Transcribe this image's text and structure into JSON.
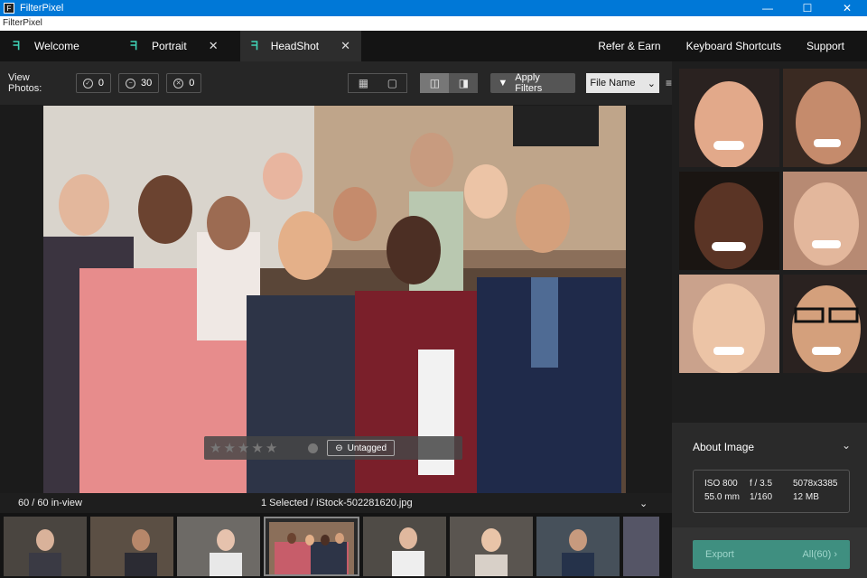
{
  "window": {
    "title": "FilterPixel",
    "menu": "FilterPixel"
  },
  "tabs": [
    {
      "label": "Welcome",
      "closable": false
    },
    {
      "label": "Portrait",
      "closable": true
    },
    {
      "label": "HeadShot",
      "closable": true,
      "active": true
    }
  ],
  "topnav": {
    "refer": "Refer & Earn",
    "shortcuts": "Keyboard Shortcuts",
    "support": "Support"
  },
  "toolbar": {
    "view_label": "View Photos:",
    "counts": {
      "accepted": "0",
      "neutral": "30",
      "rejected": "0"
    },
    "apply_label": "Apply Filters",
    "sort_value": "File Name"
  },
  "rating": {
    "stars": 5,
    "tag_label": "Untagged"
  },
  "status": {
    "in_view": "60 / 60 in-view",
    "selected": "1 Selected / iStock-502281620.jpg"
  },
  "about": {
    "title": "About Image",
    "iso": "ISO 800",
    "aperture": "f / 3.5",
    "resolution": "5078x3385",
    "focal": "55.0 mm",
    "shutter": "1/160",
    "size": "12 MB"
  },
  "export": {
    "label": "Export",
    "scope": "All(60)"
  },
  "colors": {
    "accent": "#3f8f80",
    "titlebar": "#0078d7",
    "logo": "#3fd0b4"
  }
}
